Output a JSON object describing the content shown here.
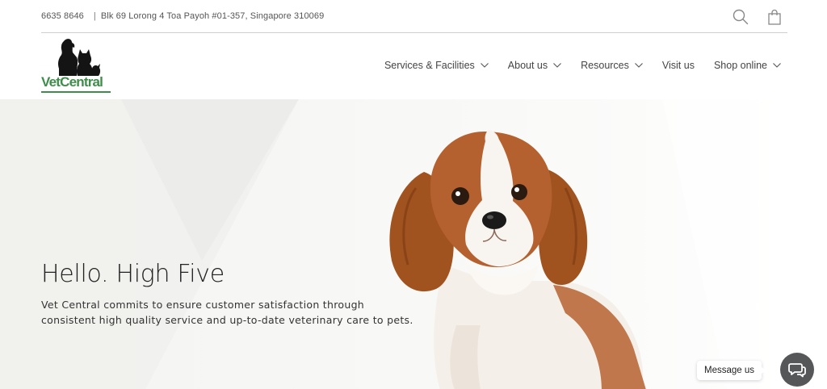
{
  "topbar": {
    "phone": "6635 8646",
    "separator": "|",
    "address": "Blk 69 Lorong 4 Toa Payoh #01-357, Singapore 310069",
    "icons": [
      "search-icon",
      "shopping-bag-icon"
    ]
  },
  "logo": {
    "wordmark": "VetCentral",
    "color": "#3e8d4a"
  },
  "nav": {
    "items": [
      {
        "label": "Services & Facilities",
        "has_dropdown": true
      },
      {
        "label": "About us",
        "has_dropdown": true
      },
      {
        "label": "Resources",
        "has_dropdown": true
      },
      {
        "label": "Visit us",
        "has_dropdown": false
      },
      {
        "label": "Shop online",
        "has_dropdown": true
      }
    ]
  },
  "hero": {
    "title": "Hello. High Five",
    "description": "Vet Central commits to ensure customer satisfaction through consistent high quality service and up-to-date veterinary care to pets."
  },
  "chat": {
    "label": "Message us",
    "icon": "chat-bubbles-icon",
    "button_color": "#555759"
  }
}
